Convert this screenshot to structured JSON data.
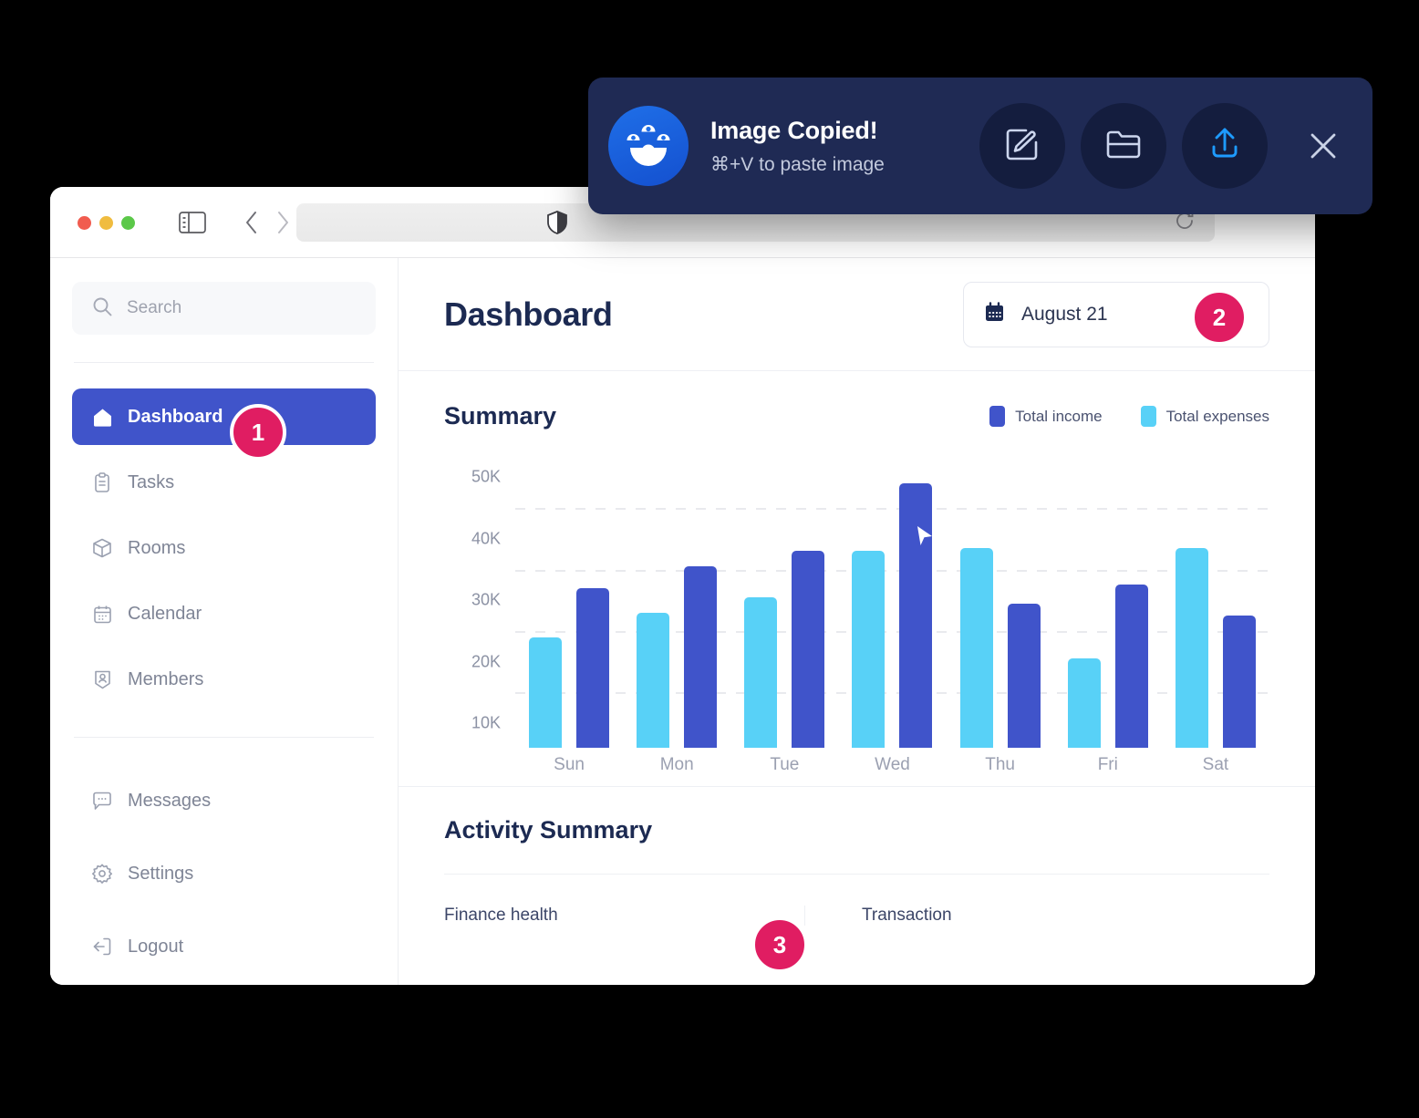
{
  "toast": {
    "title": "Image Copied!",
    "subtitle": "⌘+V to paste image",
    "logo_icon": "cleanshot-logo-icon",
    "actions": [
      {
        "name": "annotate-button",
        "icon": "pencil-square-icon"
      },
      {
        "name": "save-to-folder-button",
        "icon": "folder-icon"
      },
      {
        "name": "upload-button",
        "icon": "upload-arrow-icon"
      }
    ],
    "close_icon": "close-icon"
  },
  "browser": {
    "traffic_lights": [
      "close",
      "minimize",
      "zoom"
    ],
    "sidebar_toggle_icon": "sidebar-toggle-icon",
    "back_icon": "chevron-left-icon",
    "forward_icon": "chevron-right-icon",
    "shield_icon": "shield-icon",
    "reload_icon": "reload-icon"
  },
  "sidebar": {
    "search": {
      "placeholder": "Search",
      "value": "",
      "icon": "search-icon"
    },
    "primary_items": [
      {
        "label": "Dashboard",
        "icon": "home-icon",
        "active": true
      },
      {
        "label": "Tasks",
        "icon": "clipboard-icon",
        "active": false
      },
      {
        "label": "Rooms",
        "icon": "cube-icon",
        "active": false
      },
      {
        "label": "Calendar",
        "icon": "calendar-icon",
        "active": false
      },
      {
        "label": "Members",
        "icon": "member-badge-icon",
        "active": false
      }
    ],
    "secondary_items": [
      {
        "label": "Messages",
        "icon": "chat-bubble-icon"
      },
      {
        "label": "Settings",
        "icon": "gear-icon"
      },
      {
        "label": "Logout",
        "icon": "logout-icon"
      }
    ]
  },
  "header": {
    "title": "Dashboard",
    "date_picker": {
      "label": "August 21",
      "icon": "calendar-icon",
      "caret": "chevron-down-icon"
    }
  },
  "summary": {
    "title": "Summary"
  },
  "activity": {
    "title": "Activity Summary",
    "columns": [
      {
        "label": "Finance health"
      },
      {
        "label": "Transaction"
      }
    ]
  },
  "badges": [
    {
      "id": "1",
      "label": "1"
    },
    {
      "id": "2",
      "label": "2"
    },
    {
      "id": "3",
      "label": "3"
    }
  ],
  "colors": {
    "income": "#4054CA",
    "expenses": "#58D1F7",
    "badge": "#E01D62",
    "toast_bg": "#1F2A54",
    "title": "#1C2A52"
  },
  "chart_data": {
    "type": "bar",
    "title": "Summary",
    "xlabel": "",
    "ylabel": "",
    "categories": [
      "Sun",
      "Mon",
      "Tue",
      "Wed",
      "Thu",
      "Fri",
      "Sat"
    ],
    "series": [
      {
        "name": "Total expenses",
        "color": "#58D1F7",
        "values": [
          24000,
          28000,
          30500,
          38000,
          38500,
          20500,
          38500
        ]
      },
      {
        "name": "Total income",
        "color": "#4054CA",
        "values": [
          32000,
          35500,
          38000,
          49000,
          29500,
          32500,
          27500
        ]
      }
    ],
    "yticks": [
      10000,
      20000,
      30000,
      40000,
      50000
    ],
    "ytick_labels": [
      "10K",
      "20K",
      "30K",
      "40K",
      "50K"
    ],
    "gridlines": [
      15000,
      25000,
      35000,
      45000
    ],
    "ylim": [
      6000,
      52000
    ],
    "grid": true,
    "legend_position": "top-right",
    "legend": [
      "Total income",
      "Total expenses"
    ],
    "annotation": {
      "type": "cursor-pointer",
      "at_category": "Wed",
      "at_series": "Total income"
    }
  }
}
